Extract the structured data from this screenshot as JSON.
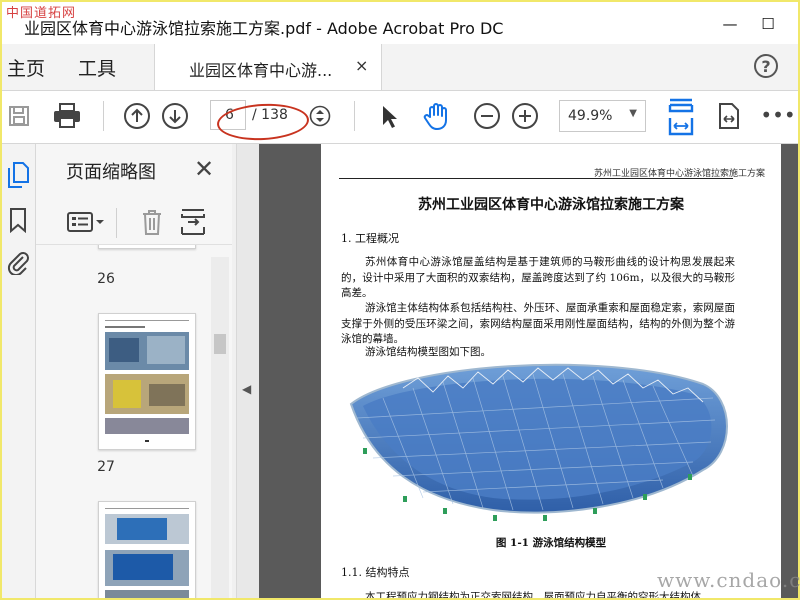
{
  "window": {
    "title": "业园区体育中心游泳馆拉索施工方案.pdf - Adobe Acrobat Pro DC",
    "watermark_top_left": "中国道拓网",
    "minimize": "—",
    "maximize": "☐"
  },
  "nav": {
    "home": "主页",
    "tools": "工具",
    "tab_label": "业园区体育中心游...",
    "tab_close": "×",
    "help": "?"
  },
  "toolbar": {
    "page_current": "6",
    "page_total": "/ 138",
    "zoom": "49.9%"
  },
  "thumbnails": {
    "title": "页面缩略图",
    "close": "✕",
    "pages": [
      "26",
      "27"
    ]
  },
  "document": {
    "header_right": "苏州工业园区体育中心游泳馆拉索施工方案",
    "title": "苏州工业园区体育中心游泳馆拉索施工方案",
    "section1": "1. 工程概况",
    "para1": "苏州体育中心游泳馆屋盖结构是基于建筑师的马鞍形曲线的设计构思发展起来的，设计中采用了大面积的双索结构，屋盖跨度达到了约 106m，以及很大的马鞍形高差。",
    "para2": "游泳馆主体结构体系包括结构柱、外压环、屋面承重索和屋面稳定索，索网屋面支撑于外侧的受压环梁之间，索网结构屋面采用刚性屋面结构，结构的外侧为整个游泳馆的幕墙。",
    "para3": "游泳馆结构模型图如下图。",
    "caption": "图 1-1 游泳馆结构模型",
    "section11": "1.1. 结构特点",
    "para4": "本工程预应力钢结构为正交索网结构，屋面预应力自平衡的空形大结构体"
  },
  "watermark_bottom_right": "www.cndao.com",
  "colors": {
    "annotation_circle": "#c8331f",
    "accent_blue": "#1473e6",
    "frame": "#f1e86a"
  }
}
